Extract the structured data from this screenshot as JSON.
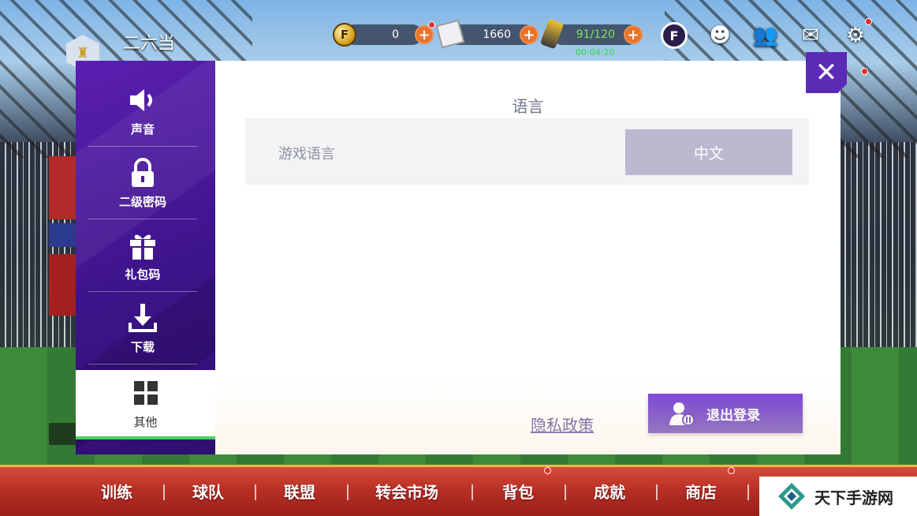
{
  "top": {
    "player_name": "二六当",
    "currencies": [
      {
        "name": "f-coin",
        "value": "0"
      },
      {
        "name": "tickets",
        "value": "1660"
      },
      {
        "name": "energy",
        "value": "91/120"
      }
    ],
    "timer": "00:04:20"
  },
  "settings": {
    "menu": [
      {
        "id": "sound",
        "label": "声音",
        "icon": "speaker-icon"
      },
      {
        "id": "password",
        "label": "二级密码",
        "icon": "lock-icon"
      },
      {
        "id": "giftcode",
        "label": "礼包码",
        "icon": "gift-icon"
      },
      {
        "id": "download",
        "label": "下载",
        "icon": "download-icon"
      },
      {
        "id": "other",
        "label": "其他",
        "icon": "grid-icon",
        "active": true
      }
    ],
    "section_title": "语言",
    "language_label": "游戏语言",
    "language_value": "中文",
    "privacy_link": "隐私政策",
    "logout_label": "退出登录"
  },
  "nav": {
    "items": [
      "训练",
      "球队",
      "联盟",
      "转会市场",
      "背包",
      "成就",
      "商店"
    ]
  },
  "watermark": {
    "text": "天下手游网"
  },
  "colors": {
    "accent_purple": "#5a1fb0",
    "active_green": "#44d65a",
    "nav_red": "#b52e24"
  }
}
